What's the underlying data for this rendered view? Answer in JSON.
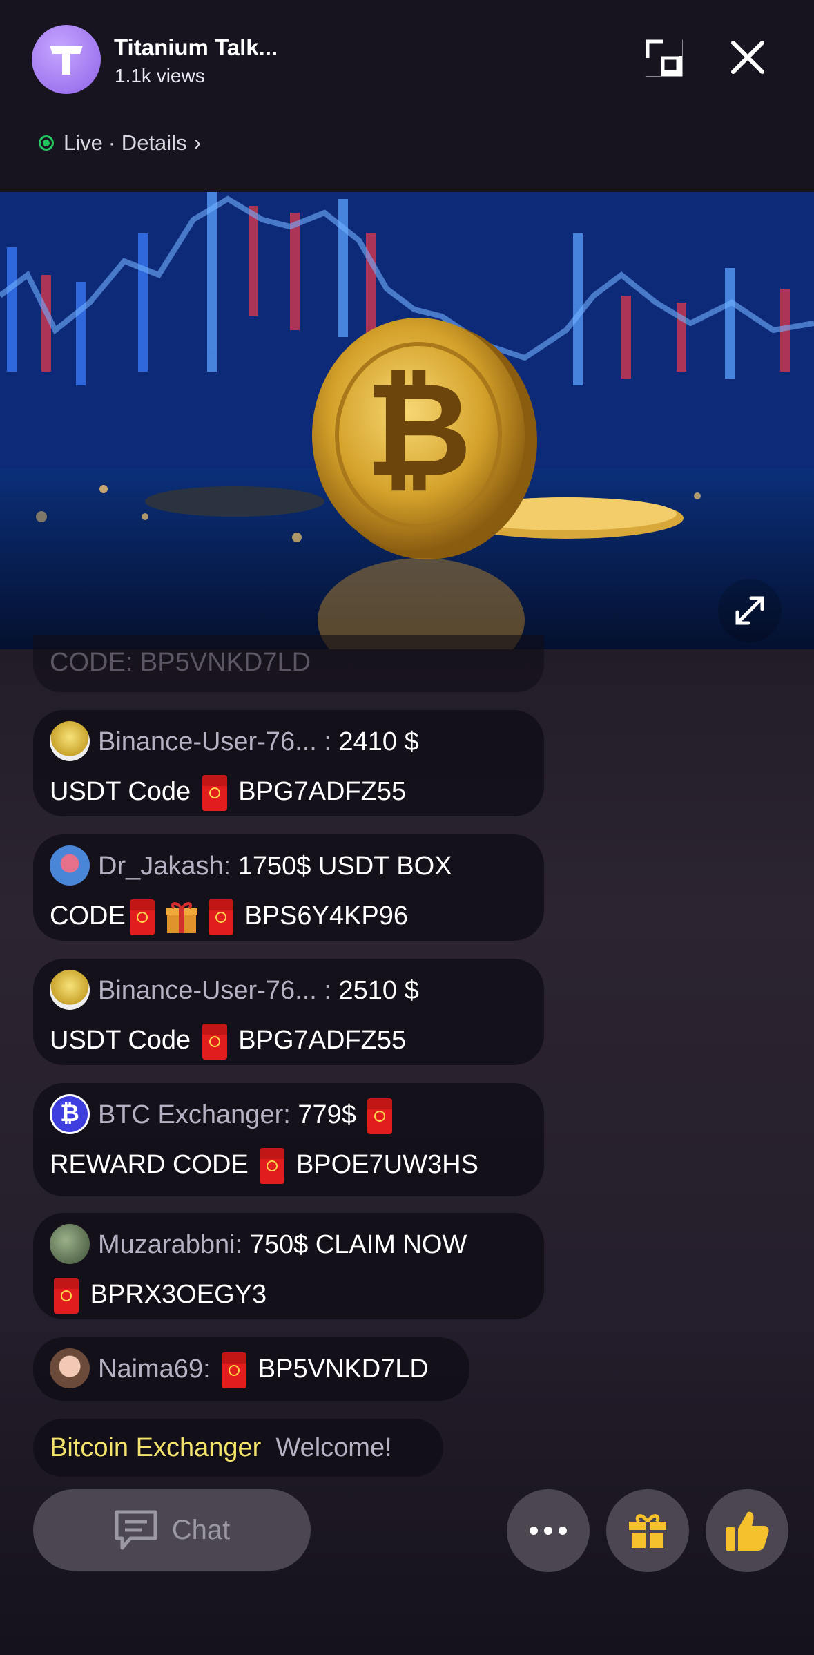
{
  "header": {
    "channel_name": "Titanium Talk...",
    "views": "1.1k views",
    "live_label": "Live",
    "details_label": "· Details"
  },
  "partial_message": "CODE: BP5VNKD7LD",
  "chat": [
    {
      "user": "Binance-User-76... :",
      "line1": "2410 $",
      "line2a": "USDT Code",
      "line2b": "BPG7ADFZ55"
    },
    {
      "user": "Dr_Jakash:",
      "line1": "1750$ USDT BOX",
      "line2a": "CODE",
      "line2b": "BPS6Y4KP96"
    },
    {
      "user": "Binance-User-76... :",
      "line1": "2510 $",
      "line2a": "USDT Code",
      "line2b": "BPG7ADFZ55"
    },
    {
      "user": "BTC Exchanger:",
      "line1": "779$",
      "line2a": "REWARD  CODE",
      "line2b": "BPOE7UW3HS"
    },
    {
      "user": "Muzarabbni:",
      "line1": "750$ CLAIM NOW",
      "line2b": "BPRX3OEGY3"
    },
    {
      "user": "Naima69:",
      "line1": "BP5VNKD7LD"
    }
  ],
  "welcome": {
    "name": "Bitcoin Exchanger",
    "text": "Welcome!"
  },
  "bottom": {
    "chat_label": "Chat",
    "more_label": "···"
  },
  "colors": {
    "live_green": "#22c55e",
    "welcome_yellow": "#f5e46b",
    "accent_purple": "#a37cf0"
  }
}
